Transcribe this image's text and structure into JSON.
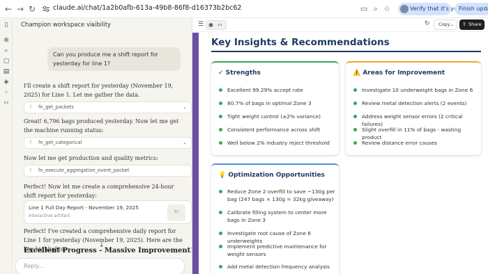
{
  "browser": {
    "url": "claude.ai/chat/1a2b0afb-613a-49b8-86f8-d16373b2bc62",
    "verify_label": "Verify that it's you",
    "finish_label": "Finish update"
  },
  "chat": {
    "title": "Champion workspace visibility",
    "user_message": "Can you produce me a shift report for yesterday for line 1?",
    "messages": [
      "I'll create a shift report for yesterday (November 19, 2025) for Line 1. Let me gather the data.",
      "Great! 6,796 bags produced yesterday. Now let me get the machine running status:",
      "Now let me get production and quality metrics:",
      "Perfect! Now let me create a comprehensive 24-hour shift report for yesterday:",
      "Perfect! I've created a comprehensive daily report for Line 1 for yesterday (November 19, 2025). Here are the key highlights:"
    ],
    "tools": [
      "fn_get_packets",
      "fn_get_categorical",
      "fn_execute_aggregation_event_packet"
    ],
    "artifact": {
      "title": "Line 1 Full Day Report - November 19, 2025",
      "subtitle": "Interactive artifact"
    },
    "highlight": "Excellent Progress - Massive Improvement! 🎉",
    "reply_placeholder": "Reply..."
  },
  "toolbar": {
    "copy_label": "Copy",
    "share_label": "Share"
  },
  "report": {
    "title": "Key Insights & Recommendations",
    "strengths": {
      "heading": "✓ Strengths",
      "items": [
        "Excellent 99.29% accept rate",
        "80.7% of bags in optimal Zone 3",
        "Tight weight control (±2% variance)",
        "Consistent performance across shift",
        "Well below 2% industry reject threshold"
      ]
    },
    "improvement": {
      "heading": "⚠️ Areas for Improvement",
      "items": [
        "Investigate 10 underweight bags in Zone 6",
        "Review metal detection alerts (2 events)",
        "Address weight sensor errors (2 critical failures)",
        "Slight overfill in 11% of bags - wasting product",
        "Review distance error causes"
      ]
    },
    "optimization": {
      "heading": "💡 Optimization Opportunities",
      "items": [
        "Reduce Zone 2 overfill to save ~130g per bag (247 bags × 130g = 32kg giveaway)",
        "Calibrate filling system to center more bags in Zone 3",
        "Investigate root cause of Zone 6 underweights",
        "Implement predictive maintenance for weight sensors",
        "Add metal detection frequency analysis"
      ]
    },
    "colors": {
      "accent": "#1f3a63",
      "purple": "#6c4fa3",
      "bullet": "#34a853",
      "strengths_top": "#34a853",
      "improvement_top": "#f5a623",
      "optimization_top": "#4a90e2"
    }
  }
}
